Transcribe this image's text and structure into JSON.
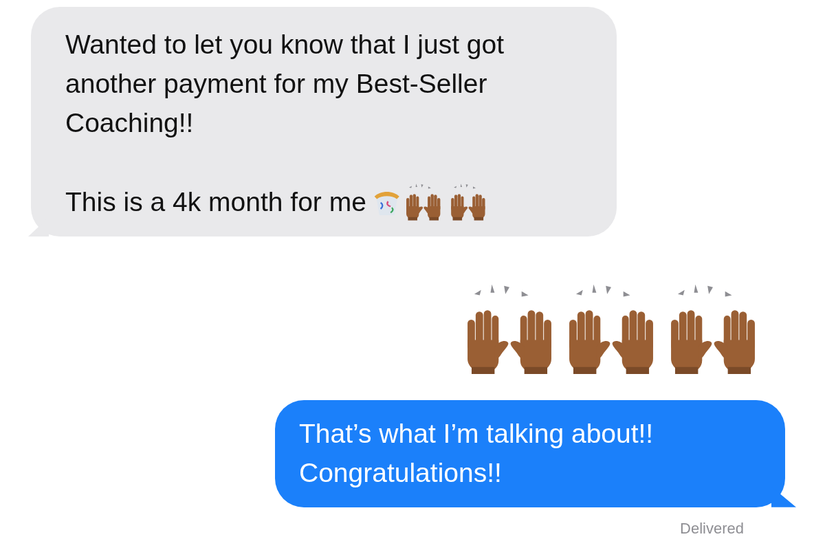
{
  "messages": [
    {
      "kind": "incoming",
      "paragraphs": [
        "Wanted to let you know that I just got another payment for my Best-Seller Coaching!!",
        "This is a 4k month for me"
      ],
      "trailing_emoji": true
    },
    {
      "kind": "outgoing-emoji"
    },
    {
      "kind": "outgoing",
      "paragraphs": [
        "That’s what I’m talking about!! Congratulations!!"
      ]
    }
  ],
  "status": "Delivered"
}
